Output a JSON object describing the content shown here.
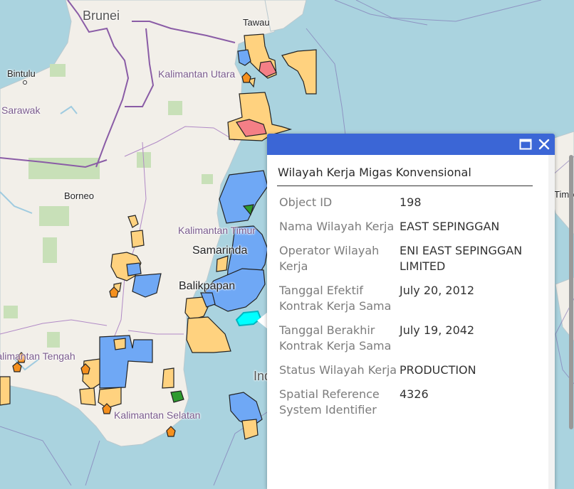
{
  "map": {
    "labels": {
      "brunei": "Brunei",
      "tawau": "Tawau",
      "bintulu": "Bintulu",
      "kaltara": "Kalimantan Utara",
      "sarawak": "Sarawak",
      "borneo": "Borneo",
      "kaltim": "Kalimantan Timur",
      "samarinda": "Samarinda",
      "balikpapan": "Balikpapan",
      "kalteng": "Kalimantan Tengah",
      "kalsel": "Kalimantan Selatan",
      "indonesia": "Indonesia",
      "timor": "Timor"
    },
    "colors": {
      "sea": "#aad3df",
      "land": "#f2efe9",
      "forest": "#c8e0b8",
      "block_production": "#ffd27f",
      "block_exploration": "#6fa8f5",
      "block_other": "#f47f86",
      "block_green": "#2e9a2e",
      "block_orange": "#f5901e",
      "selected": "#00ffff",
      "border": "#7b4f96"
    }
  },
  "popup": {
    "title": "Wilayah Kerja Migas Konvensional",
    "header_color": "#3b66d6",
    "icons": {
      "maximize": "maximize-icon",
      "close": "close-icon"
    },
    "fields": [
      {
        "label": "Object ID",
        "value": "198"
      },
      {
        "label": "Nama Wilayah Kerja",
        "value": "EAST SEPINGGAN"
      },
      {
        "label": "Operator Wilayah Kerja",
        "value": "ENI EAST SEPINGGAN LIMITED"
      },
      {
        "label": "Tanggal Efektif Kontrak Kerja Sama",
        "value": "July 20, 2012"
      },
      {
        "label": "Tanggal Berakhir Kontrak Kerja Sama",
        "value": "July 19, 2042"
      },
      {
        "label": "Status Wilayah Kerja",
        "value": "PRODUCTION"
      },
      {
        "label": "Spatial Reference System Identifier",
        "value": "4326"
      }
    ]
  }
}
